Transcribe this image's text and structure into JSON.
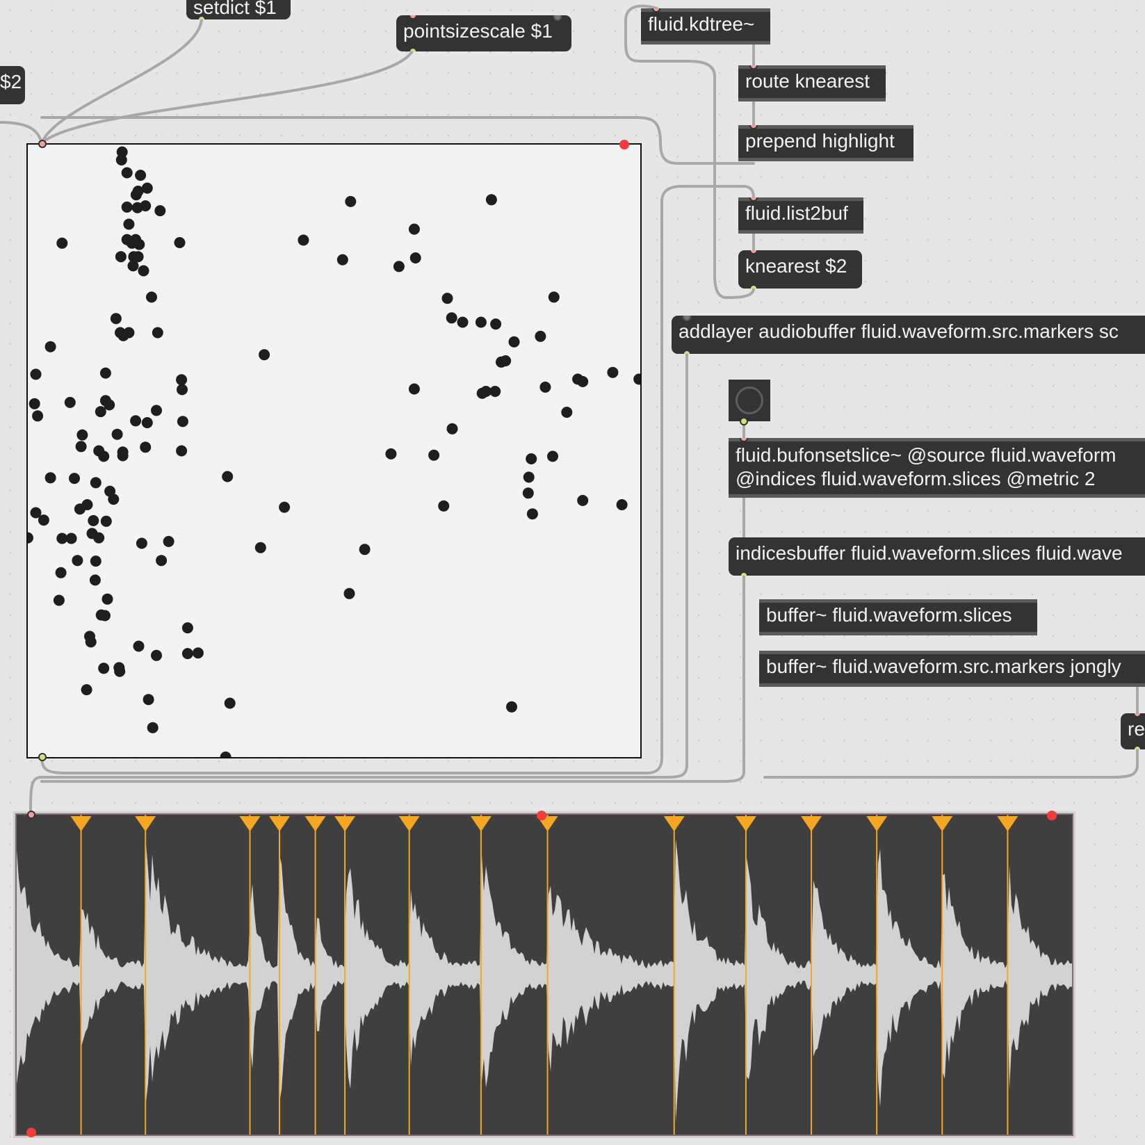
{
  "patcher": {
    "objects": {
      "setdict": "setdict $1",
      "pointsizescale": "pointsizescale $1",
      "left_edge": "$2",
      "kdtree": "fluid.kdtree~",
      "route": "route knearest",
      "prepend": "prepend highlight",
      "list2buf": "fluid.list2buf",
      "knearest": "knearest $2",
      "addlayer": "addlayer audiobuffer fluid.waveform.src.markers sc",
      "bufonsetslice_line1": "fluid.bufonsetslice~ @source fluid.waveform",
      "bufonsetslice_line2": "@indices fluid.waveform.slices @metric 2",
      "indicesbuffer": "indicesbuffer fluid.waveform.slices fluid.wave",
      "buffer_slices": "buffer~ fluid.waveform.slices",
      "buffer_markers": "buffer~ fluid.waveform.src.markers jongly",
      "re_partial": "re"
    }
  },
  "colors": {
    "canvas": "#e6e6e6",
    "object_bg": "#333333",
    "object_text": "#f2f2f2",
    "inlet": "#f4a09a",
    "outlet": "#d6e07a",
    "patch_cord": "#a8a8a8",
    "plot_bg": "#f3f3f3",
    "point": "#1e1e1e",
    "wave_bg": "#3f3f3f",
    "wave_fill": "#d2d2d2",
    "slice_marker": "#f5a623",
    "highlight_dot": "#f23b3b"
  },
  "icons": {
    "toggle": "bang-circle-icon",
    "slice_marker": "orange-triangle-marker-icon"
  },
  "chart_data": {
    "type": "scatter",
    "xlim": [
      0,
      1
    ],
    "ylim": [
      0,
      1
    ],
    "points": [
      [
        0.154,
        0.988
      ],
      [
        0.153,
        0.975
      ],
      [
        0.162,
        0.954
      ],
      [
        0.184,
        0.95
      ],
      [
        0.18,
        0.924
      ],
      [
        0.177,
        0.918
      ],
      [
        0.195,
        0.929
      ],
      [
        0.162,
        0.898
      ],
      [
        0.179,
        0.897
      ],
      [
        0.192,
        0.9
      ],
      [
        0.216,
        0.892
      ],
      [
        0.056,
        0.839
      ],
      [
        0.165,
        0.87
      ],
      [
        0.162,
        0.845
      ],
      [
        0.176,
        0.845
      ],
      [
        0.182,
        0.837
      ],
      [
        0.17,
        0.839
      ],
      [
        0.248,
        0.84
      ],
      [
        0.152,
        0.817
      ],
      [
        0.173,
        0.817
      ],
      [
        0.18,
        0.817
      ],
      [
        0.172,
        0.802
      ],
      [
        0.189,
        0.794
      ],
      [
        0.202,
        0.751
      ],
      [
        0.527,
        0.907
      ],
      [
        0.757,
        0.91
      ],
      [
        0.45,
        0.844
      ],
      [
        0.631,
        0.862
      ],
      [
        0.633,
        0.815
      ],
      [
        0.514,
        0.812
      ],
      [
        0.606,
        0.801
      ],
      [
        0.685,
        0.749
      ],
      [
        0.859,
        0.751
      ],
      [
        0.71,
        0.71
      ],
      [
        0.692,
        0.717
      ],
      [
        0.74,
        0.71
      ],
      [
        0.764,
        0.707
      ],
      [
        0.837,
        0.687
      ],
      [
        0.794,
        0.678
      ],
      [
        0.78,
        0.647
      ],
      [
        0.773,
        0.645
      ],
      [
        0.955,
        0.628
      ],
      [
        0.998,
        0.617
      ],
      [
        0.906,
        0.613
      ],
      [
        0.898,
        0.617
      ],
      [
        0.845,
        0.604
      ],
      [
        0.748,
        0.597
      ],
      [
        0.763,
        0.597
      ],
      [
        0.742,
        0.594
      ],
      [
        0.631,
        0.601
      ],
      [
        0.88,
        0.563
      ],
      [
        0.693,
        0.536
      ],
      [
        0.144,
        0.716
      ],
      [
        0.151,
        0.693
      ],
      [
        0.156,
        0.688
      ],
      [
        0.165,
        0.693
      ],
      [
        0.212,
        0.693
      ],
      [
        0.037,
        0.67
      ],
      [
        0.386,
        0.657
      ],
      [
        0.013,
        0.625
      ],
      [
        0.127,
        0.627
      ],
      [
        0.251,
        0.616
      ],
      [
        0.252,
        0.6
      ],
      [
        0.011,
        0.577
      ],
      [
        0.069,
        0.579
      ],
      [
        0.127,
        0.582
      ],
      [
        0.133,
        0.575
      ],
      [
        0.119,
        0.564
      ],
      [
        0.016,
        0.557
      ],
      [
        0.176,
        0.549
      ],
      [
        0.195,
        0.546
      ],
      [
        0.21,
        0.566
      ],
      [
        0.253,
        0.548
      ],
      [
        0.089,
        0.526
      ],
      [
        0.146,
        0.527
      ],
      [
        0.087,
        0.507
      ],
      [
        0.192,
        0.506
      ],
      [
        0.155,
        0.498
      ],
      [
        0.155,
        0.492
      ],
      [
        0.251,
        0.5
      ],
      [
        0.116,
        0.5
      ],
      [
        0.124,
        0.491
      ],
      [
        0.593,
        0.495
      ],
      [
        0.663,
        0.493
      ],
      [
        0.822,
        0.487
      ],
      [
        0.818,
        0.457
      ],
      [
        0.817,
        0.431
      ],
      [
        0.857,
        0.491
      ],
      [
        0.326,
        0.458
      ],
      [
        0.037,
        0.456
      ],
      [
        0.076,
        0.455
      ],
      [
        0.111,
        0.448
      ],
      [
        0.134,
        0.434
      ],
      [
        0.14,
        0.421
      ],
      [
        0.097,
        0.412
      ],
      [
        0.013,
        0.399
      ],
      [
        0.026,
        0.387
      ],
      [
        0.085,
        0.405
      ],
      [
        0.107,
        0.386
      ],
      [
        0.128,
        0.385
      ],
      [
        0.0,
        0.358
      ],
      [
        0.056,
        0.357
      ],
      [
        0.071,
        0.357
      ],
      [
        0.105,
        0.365
      ],
      [
        0.116,
        0.358
      ],
      [
        0.186,
        0.349
      ],
      [
        0.23,
        0.352
      ],
      [
        0.419,
        0.408
      ],
      [
        0.55,
        0.339
      ],
      [
        0.679,
        0.41
      ],
      [
        0.824,
        0.397
      ],
      [
        0.906,
        0.419
      ],
      [
        0.97,
        0.412
      ],
      [
        0.38,
        0.342
      ],
      [
        0.081,
        0.321
      ],
      [
        0.111,
        0.32
      ],
      [
        0.218,
        0.321
      ],
      [
        0.054,
        0.301
      ],
      [
        0.11,
        0.289
      ],
      [
        0.525,
        0.267
      ],
      [
        0.051,
        0.256
      ],
      [
        0.13,
        0.258
      ],
      [
        0.126,
        0.231
      ],
      [
        0.12,
        0.232
      ],
      [
        0.101,
        0.197
      ],
      [
        0.103,
        0.188
      ],
      [
        0.181,
        0.181
      ],
      [
        0.21,
        0.166
      ],
      [
        0.261,
        0.211
      ],
      [
        0.261,
        0.169
      ],
      [
        0.278,
        0.17
      ],
      [
        0.124,
        0.145
      ],
      [
        0.149,
        0.146
      ],
      [
        0.15,
        0.14
      ],
      [
        0.096,
        0.11
      ],
      [
        0.197,
        0.094
      ],
      [
        0.33,
        0.088
      ],
      [
        0.79,
        0.082
      ],
      [
        0.204,
        0.048
      ],
      [
        0.323,
        0.0
      ]
    ]
  },
  "waveform": {
    "slice_positions": [
      0.0,
      0.061,
      0.122,
      0.221,
      0.249,
      0.283,
      0.311,
      0.372,
      0.44,
      0.503,
      0.623,
      0.691,
      0.753,
      0.815,
      0.877,
      0.939
    ],
    "peaks": [
      0.98,
      0.55,
      0.9,
      0.7,
      0.96,
      0.62,
      0.88,
      0.6,
      0.95,
      0.72,
      0.94,
      0.8,
      0.7,
      0.96,
      0.78,
      0.84
    ]
  }
}
